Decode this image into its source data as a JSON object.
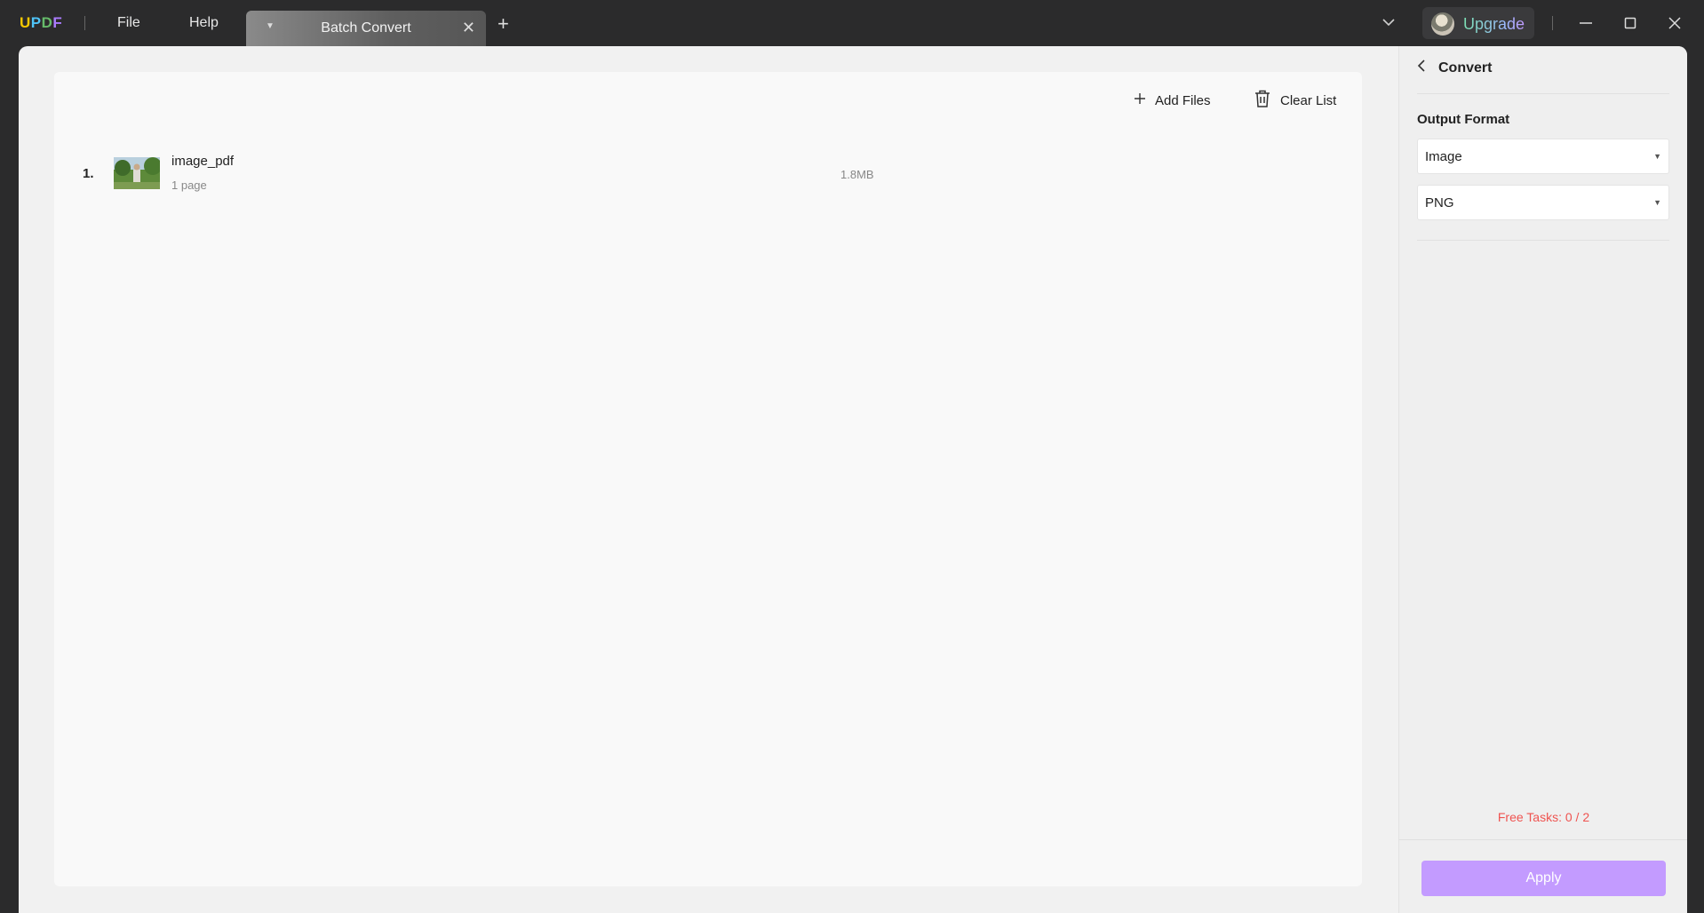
{
  "app": {
    "logo": {
      "u": "U",
      "p": "P",
      "d": "D",
      "f": "F"
    },
    "menu": {
      "file": "File",
      "help": "Help"
    },
    "tab": {
      "title": "Batch Convert"
    },
    "upgrade_label": "Upgrade"
  },
  "toolbar": {
    "add_files": "Add Files",
    "clear_list": "Clear List"
  },
  "files": [
    {
      "index": "1.",
      "name": "image_pdf",
      "pages": "1 page",
      "size": "1.8MB"
    }
  ],
  "panel": {
    "title": "Convert",
    "output_format_label": "Output Format",
    "format_value": "Image",
    "subformat_value": "PNG",
    "free_tasks": "Free Tasks: 0 / 2",
    "apply_label": "Apply"
  },
  "colors": {
    "accent": "#c39bff",
    "warning": "#ef5350",
    "titlebar": "#2b2b2c"
  },
  "icons": [
    "chevron-down-icon",
    "plus-icon",
    "close-icon",
    "trash-icon",
    "back-chevron-icon",
    "minimize-icon",
    "maximize-icon"
  ]
}
